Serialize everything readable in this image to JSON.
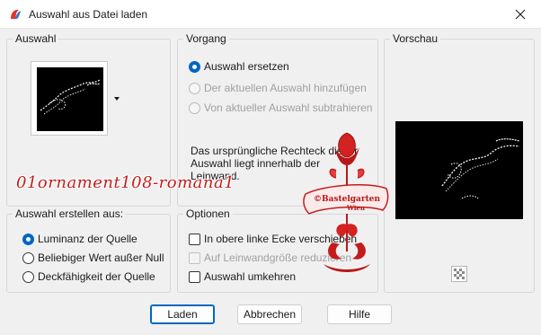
{
  "window": {
    "title": "Auswahl aus Datei laden",
    "close_icon": "close-icon",
    "app_icon": "paintshop-pro-icon"
  },
  "auswahl": {
    "legend": "Auswahl"
  },
  "vorgang": {
    "legend": "Vorgang",
    "options": [
      {
        "label": "Auswahl ersetzen",
        "checked": true,
        "enabled": true
      },
      {
        "label": "Der aktuellen Auswahl hinzufügen",
        "checked": false,
        "enabled": false
      },
      {
        "label": "Von aktueller Auswahl subtrahieren",
        "checked": false,
        "enabled": false
      }
    ],
    "info_lines": [
      "Das ursprüngliche Rechteck dieser",
      "Auswahl liegt innerhalb der",
      "Leinwand."
    ]
  },
  "vorschau": {
    "legend": "Vorschau",
    "toggle_icon": "checkerboard-icon"
  },
  "erstellen": {
    "legend": "Auswahl erstellen aus:",
    "options": [
      {
        "label": "Luminanz der Quelle",
        "checked": true
      },
      {
        "label": "Beliebiger Wert außer Null",
        "checked": false
      },
      {
        "label": "Deckfähigkeit der Quelle",
        "checked": false
      }
    ]
  },
  "optionen": {
    "legend": "Optionen",
    "checks": [
      {
        "label": "In obere linke Ecke verschieben",
        "checked": false,
        "enabled": true
      },
      {
        "label": "Auf Leinwandgröße reduzieren",
        "checked": false,
        "enabled": false
      },
      {
        "label": "Auswahl umkehren",
        "checked": false,
        "enabled": true
      }
    ]
  },
  "buttons": {
    "ok": "Laden",
    "cancel": "Abbrechen",
    "help": "Hilfe"
  },
  "overlay": {
    "watermark": "01ornament108-romana1",
    "stamp_line1": "©Bastelgarten",
    "stamp_line2": "Wien"
  },
  "colors": {
    "accent": "#0067c0",
    "watermark": "#c61a1a"
  }
}
